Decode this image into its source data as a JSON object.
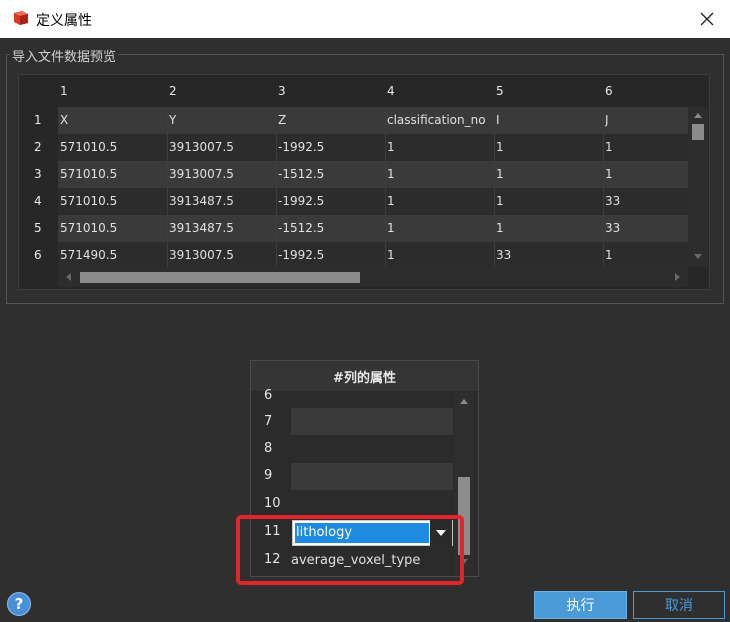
{
  "window": {
    "title": "定义属性"
  },
  "preview": {
    "group_title": "导入文件数据预览",
    "column_numbers": [
      "1",
      "2",
      "3",
      "4",
      "5",
      "6"
    ],
    "row_numbers": [
      "1",
      "2",
      "3",
      "4",
      "5",
      "6"
    ],
    "rows": [
      [
        "X",
        "Y",
        "Z",
        "classification_no",
        "I",
        "J"
      ],
      [
        "571010.5",
        "3913007.5",
        "-1992.5",
        "1",
        "1",
        "1"
      ],
      [
        "571010.5",
        "3913007.5",
        "-1512.5",
        "1",
        "1",
        "1"
      ],
      [
        "571010.5",
        "3913487.5",
        "-1992.5",
        "1",
        "1",
        "33"
      ],
      [
        "571010.5",
        "3913487.5",
        "-1512.5",
        "1",
        "1",
        "33"
      ],
      [
        "571490.5",
        "3913007.5",
        "-1992.5",
        "1",
        "33",
        "1"
      ]
    ]
  },
  "attributes": {
    "header": "#列的属性",
    "rows": [
      {
        "num": "6",
        "value": ""
      },
      {
        "num": "7",
        "value": ""
      },
      {
        "num": "8",
        "value": ""
      },
      {
        "num": "9",
        "value": ""
      },
      {
        "num": "10",
        "value": ""
      },
      {
        "num": "11",
        "value": "lithology"
      },
      {
        "num": "12",
        "value": "average_voxel_type"
      }
    ],
    "editor_value": "lithology"
  },
  "buttons": {
    "execute": "执行",
    "cancel": "取消",
    "help": "?"
  },
  "colors": {
    "accent": "#4a9ad8",
    "selection": "#1e8ae0",
    "highlight": "#e0252b"
  }
}
